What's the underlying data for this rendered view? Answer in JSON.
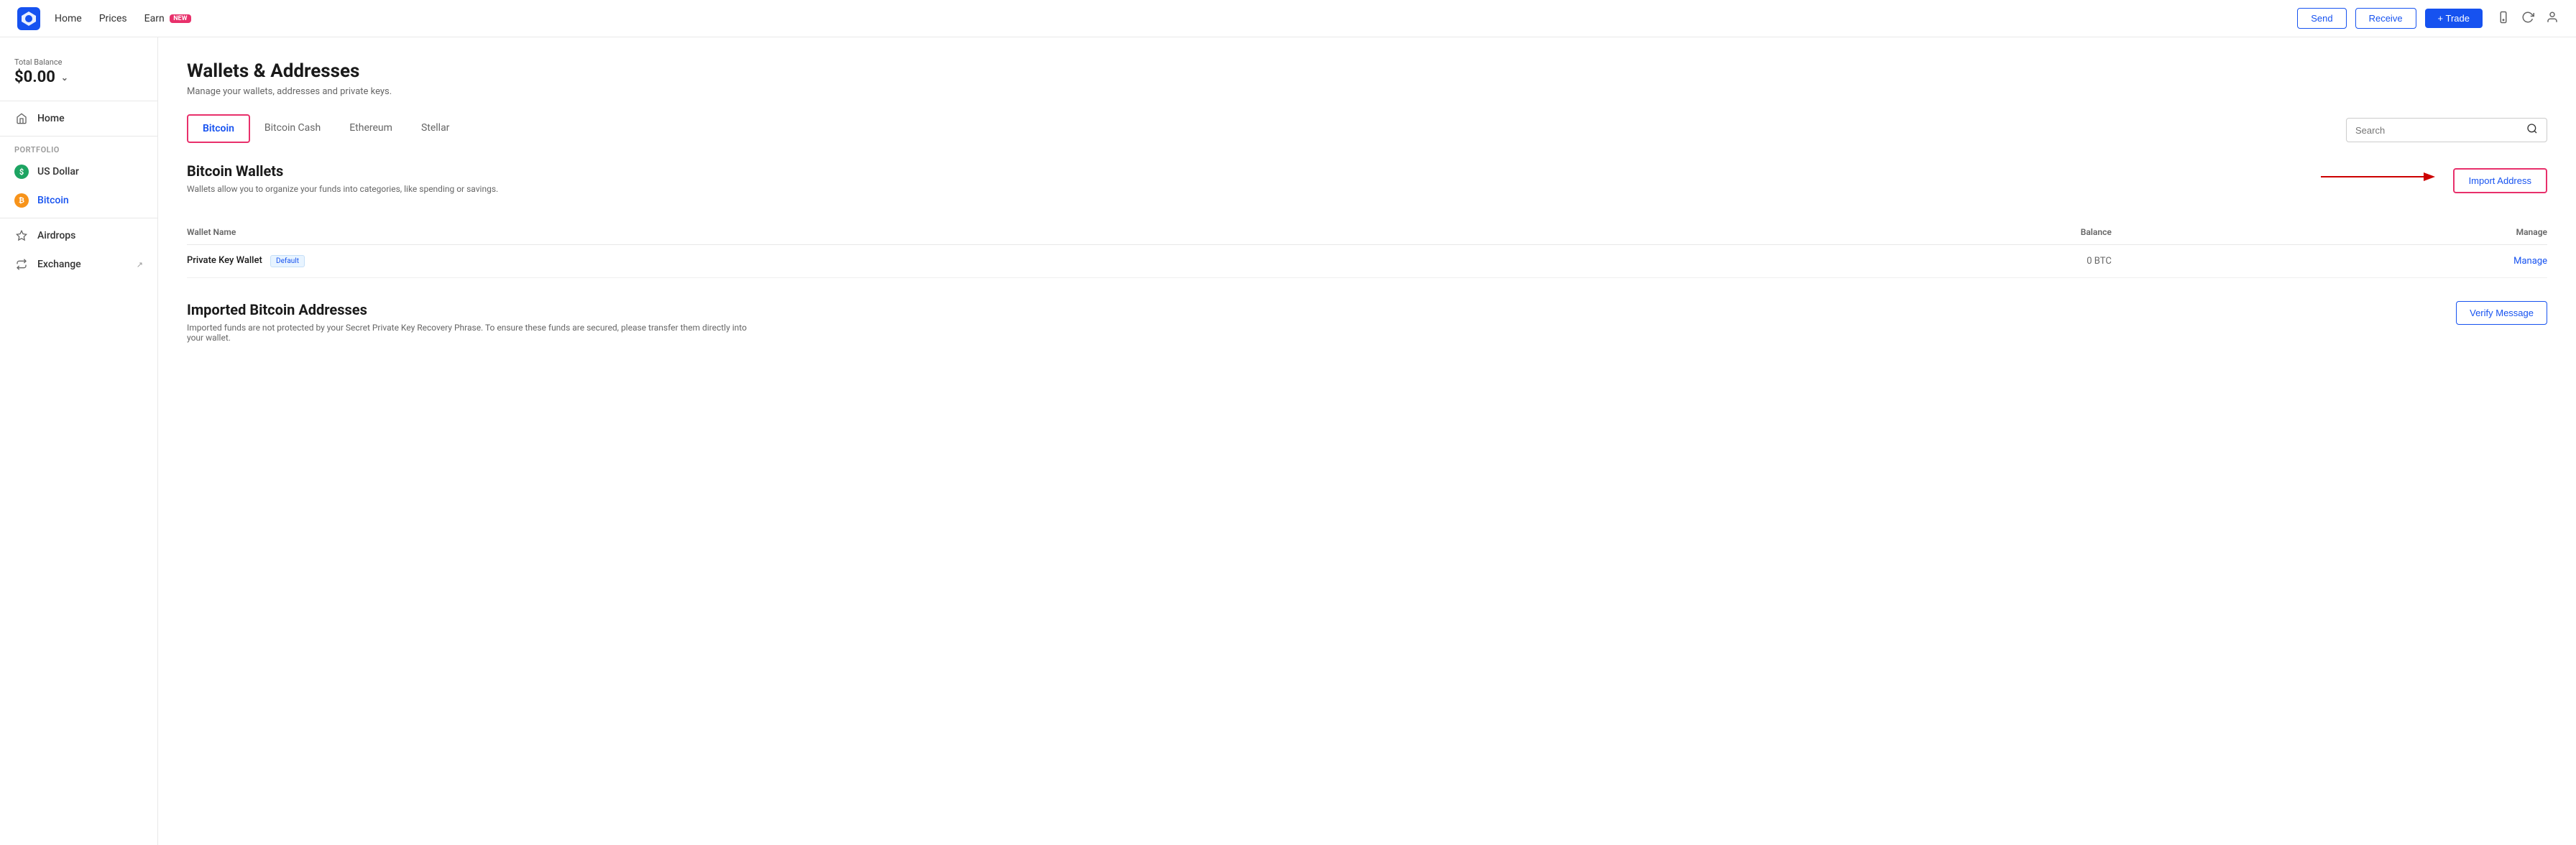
{
  "nav": {
    "links": [
      {
        "id": "home",
        "label": "Home"
      },
      {
        "id": "prices",
        "label": "Prices"
      },
      {
        "id": "earn",
        "label": "Earn",
        "badge": "NEW"
      }
    ],
    "send_label": "Send",
    "receive_label": "Receive",
    "trade_label": "+ Trade"
  },
  "sidebar": {
    "total_balance_label": "Total Balance",
    "total_balance_amount": "$0.00",
    "home_label": "Home",
    "portfolio_label": "Portfolio",
    "usd_label": "US Dollar",
    "btc_label": "Bitcoin",
    "airdrops_label": "Airdrops",
    "exchange_label": "Exchange"
  },
  "main": {
    "page_title": "Wallets & Addresses",
    "page_subtitle": "Manage your wallets, addresses and private keys.",
    "tabs": [
      {
        "id": "bitcoin",
        "label": "Bitcoin",
        "active": true
      },
      {
        "id": "bitcoin-cash",
        "label": "Bitcoin Cash",
        "active": false
      },
      {
        "id": "ethereum",
        "label": "Ethereum",
        "active": false
      },
      {
        "id": "stellar",
        "label": "Stellar",
        "active": false
      }
    ],
    "search_placeholder": "Search",
    "section_title": "Bitcoin Wallets",
    "section_subtitle": "Wallets allow you to organize your funds into categories, like spending or savings.",
    "import_address_label": "Import Address",
    "table": {
      "col_wallet_name": "Wallet Name",
      "col_balance": "Balance",
      "col_manage": "Manage",
      "rows": [
        {
          "name": "Private Key Wallet",
          "badge": "Default",
          "balance": "0 BTC",
          "manage": "Manage"
        }
      ]
    },
    "imported_section": {
      "title": "Imported Bitcoin Addresses",
      "subtitle": "Imported funds are not protected by your Secret Private Key Recovery Phrase. To ensure these funds are secured, please transfer them directly into your wallet.",
      "verify_label": "Verify Message"
    }
  }
}
